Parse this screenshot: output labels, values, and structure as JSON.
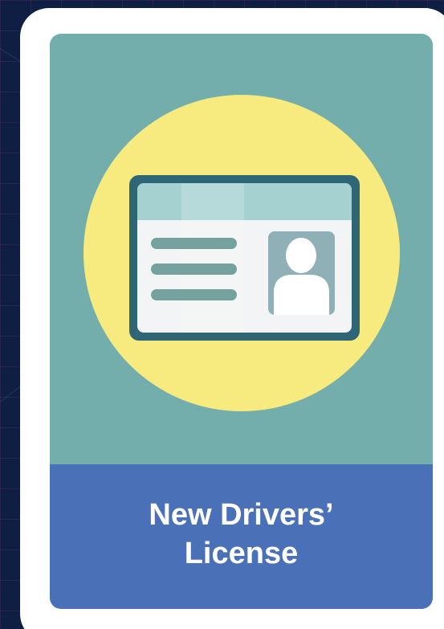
{
  "card": {
    "title": "New Drivers’\nLicense",
    "icon": "drivers-license-icon"
  },
  "colors": {
    "page_background": "#0f1f44",
    "card_border": "#ffffff",
    "illustration_background": "#73adac",
    "circle": "#f7eb7f",
    "license_frame": "#2f6676",
    "license_header": "#a6d1d1",
    "license_body": "#f2f4f5",
    "text_lines": "#75a19e",
    "photo_background": "#8eb0b6",
    "caption_background": "#4a70b7",
    "caption_text": "#ffffff"
  }
}
